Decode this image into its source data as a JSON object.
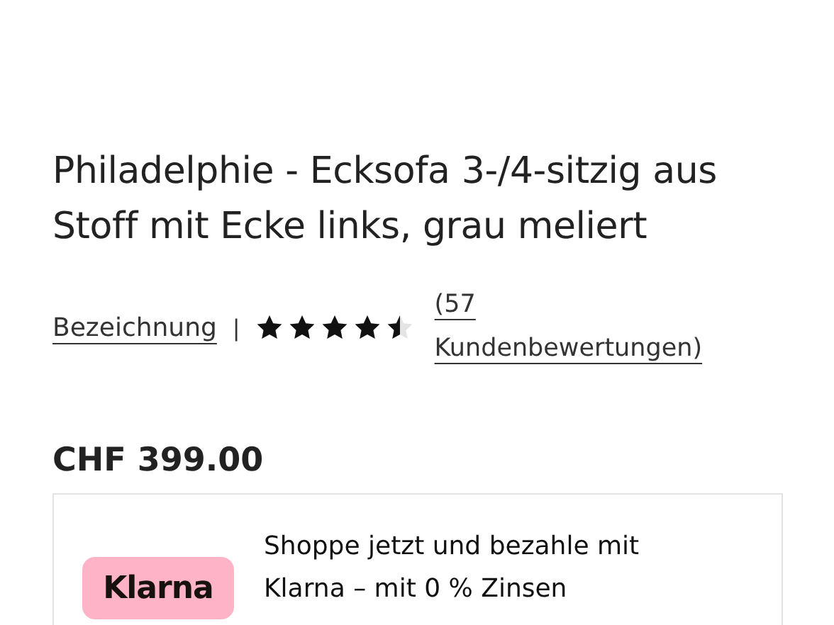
{
  "product": {
    "title": "Philadelphie - Ecksofa 3-/4-sitzig aus Stoff mit Ecke links, grau meliert",
    "designation_link": "Bezeichnung",
    "separator": "|",
    "rating": {
      "stars": 4.5,
      "reviews_link": "(57 Kundenbewertungen)"
    },
    "price": "CHF 399.00"
  },
  "klarna": {
    "logo": "Klarna",
    "lines": [
      "Shoppe jetzt und bezahle mit",
      "Klarna – mit 0 % Zinsen"
    ]
  }
}
